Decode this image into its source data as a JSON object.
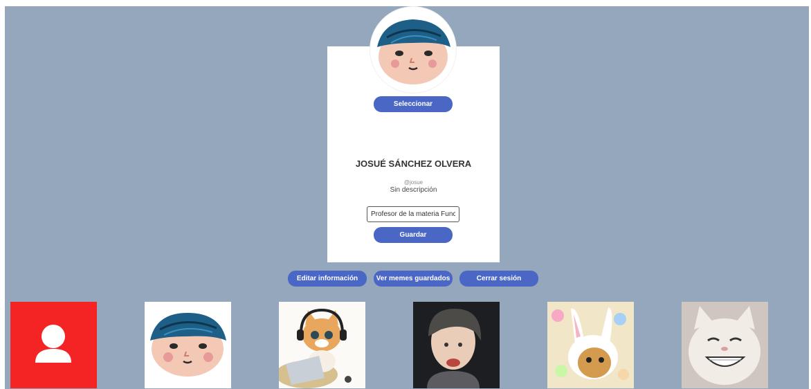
{
  "profile": {
    "name": "JOSUÉ SÁNCHEZ OLVERA",
    "handle": "@josue",
    "description": "Sin descripción",
    "description_input_value": "Profesor de la materia Func",
    "select_label": "Seleccionar",
    "save_label": "Guardar"
  },
  "actions": {
    "edit_label": "Editar información",
    "saved_memes_label": "Ver memes guardados",
    "logout_label": "Cerrar sesión"
  },
  "gallery": [
    {
      "icon": "default-user-avatar"
    },
    {
      "icon": "cartoon-face-avatar"
    },
    {
      "icon": "cat-headphones-laptop-avatar"
    },
    {
      "icon": "baby-photo-avatar"
    },
    {
      "icon": "cat-bunny-ears-avatar"
    },
    {
      "icon": "smiling-white-cat-avatar"
    }
  ],
  "colors": {
    "background": "#94a7bd",
    "button": "#4a67c6",
    "card": "#ffffff",
    "default_avatar_bg": "#f42424"
  }
}
